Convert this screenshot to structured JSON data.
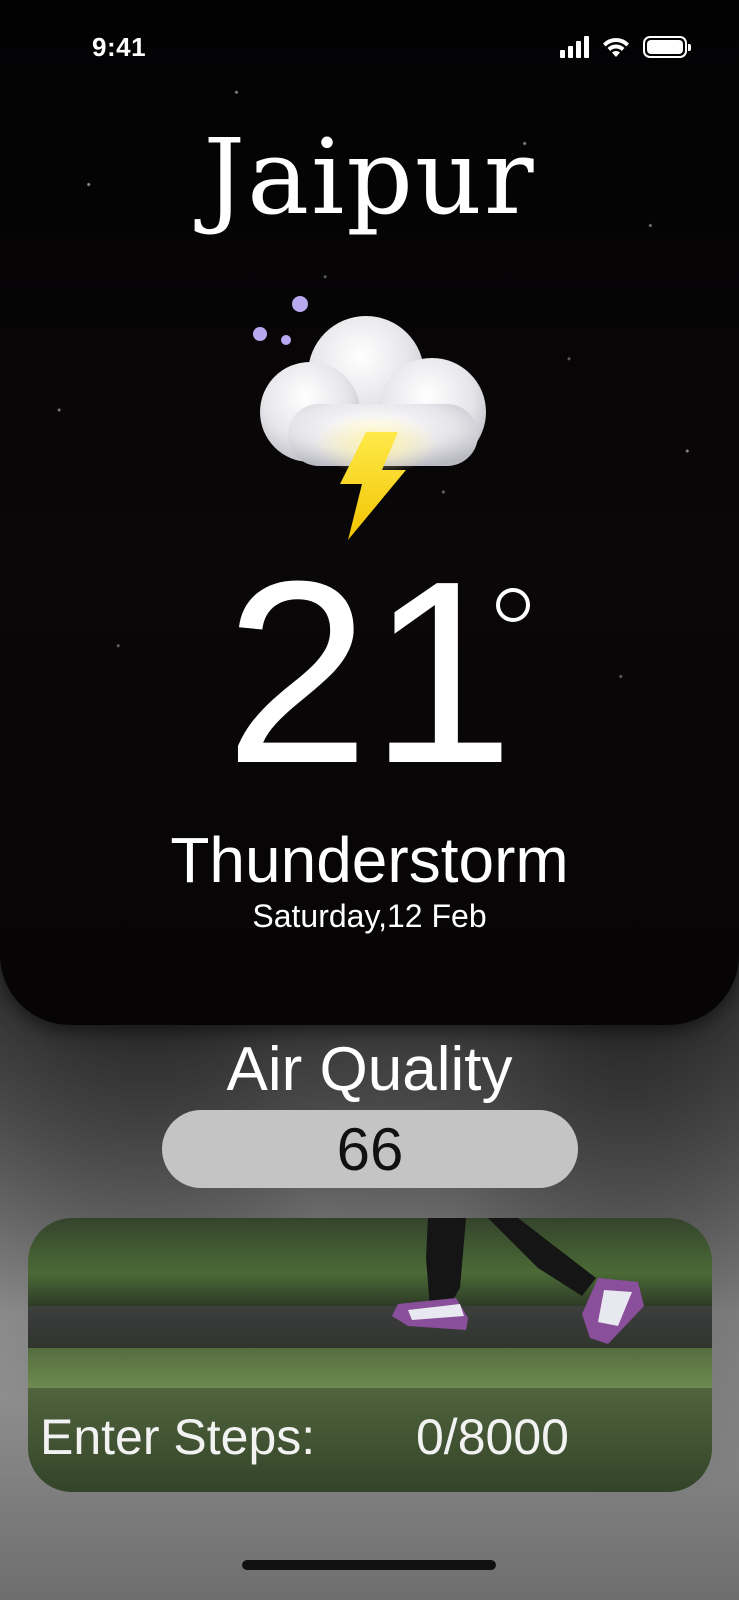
{
  "status_bar": {
    "time": "9:41"
  },
  "weather": {
    "city": "Jaipur",
    "icon": "thunderstorm-night-icon",
    "temperature": "21",
    "condition": "Thunderstorm",
    "date": "Saturday,12 Feb"
  },
  "air_quality": {
    "label": "Air Quality",
    "value": "66"
  },
  "steps": {
    "label": "Enter Steps:",
    "value": "0/8000"
  },
  "colors": {
    "card_background": "#050405",
    "pill_background": "#c4c4c4",
    "lightning": "#f6dc1e",
    "moon": "#7b6fe0"
  }
}
